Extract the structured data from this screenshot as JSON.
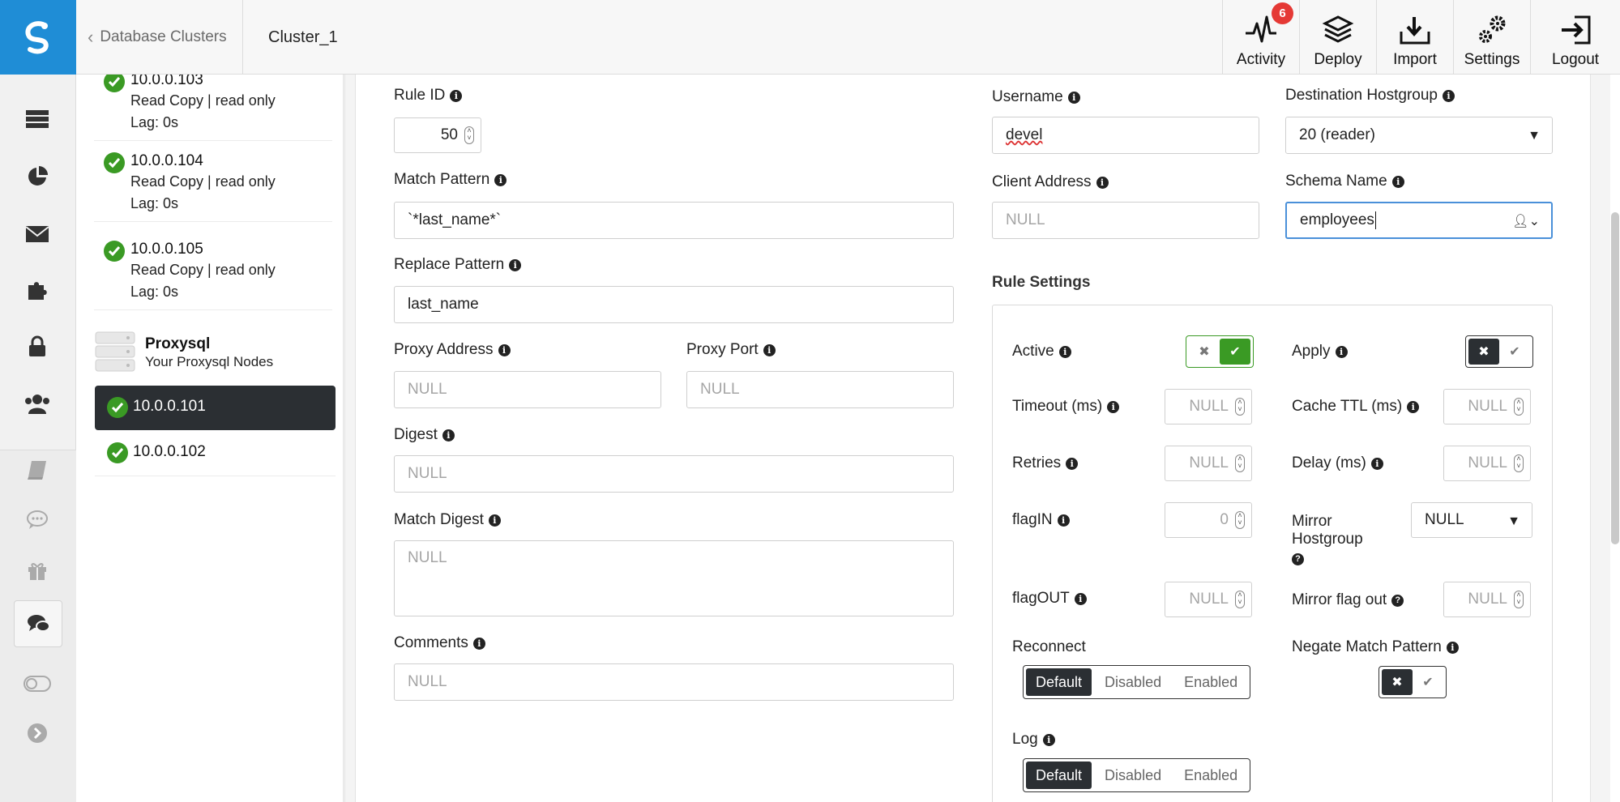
{
  "topbar": {
    "breadcrumb_label": "Database Clusters",
    "cluster_name": "Cluster_1",
    "activity": {
      "label": "Activity",
      "badge": "6"
    },
    "deploy_label": "Deploy",
    "import_label": "Import",
    "settings_label": "Settings",
    "logout_label": "Logout"
  },
  "nodes": [
    {
      "ip": "10.0.0.103",
      "role": "Read Copy | read only",
      "lag": "Lag: 0s"
    },
    {
      "ip": "10.0.0.104",
      "role": "Read Copy | read only",
      "lag": "Lag: 0s"
    },
    {
      "ip": "10.0.0.105",
      "role": "Read Copy | read only",
      "lag": "Lag: 0s"
    }
  ],
  "proxysql": {
    "title": "Proxysql",
    "subtitle": "Your Proxysql Nodes",
    "nodes": [
      "10.0.0.101",
      "10.0.0.102"
    ]
  },
  "form": {
    "rule_id": {
      "label": "Rule ID",
      "value": "50"
    },
    "match_pattern": {
      "label": "Match Pattern",
      "value": "`*last_name*`"
    },
    "replace_pattern": {
      "label": "Replace Pattern",
      "value": "last_name"
    },
    "proxy_address": {
      "label": "Proxy Address",
      "placeholder": "NULL"
    },
    "proxy_port": {
      "label": "Proxy Port",
      "placeholder": "NULL"
    },
    "digest": {
      "label": "Digest",
      "placeholder": "NULL"
    },
    "match_digest": {
      "label": "Match Digest",
      "placeholder": "NULL"
    },
    "comments": {
      "label": "Comments",
      "placeholder": "NULL"
    },
    "username": {
      "label": "Username",
      "value": "devel"
    },
    "destination_hostgroup": {
      "label": "Destination Hostgroup",
      "value": "20 (reader)"
    },
    "client_address": {
      "label": "Client Address",
      "placeholder": "NULL"
    },
    "schema_name": {
      "label": "Schema Name",
      "value": "employees"
    }
  },
  "rule_settings": {
    "title": "Rule Settings",
    "active": {
      "label": "Active",
      "state": "on"
    },
    "apply": {
      "label": "Apply",
      "state": "off"
    },
    "timeout": {
      "label": "Timeout (ms)",
      "value": "NULL"
    },
    "cache_ttl": {
      "label": "Cache TTL (ms)",
      "value": "NULL"
    },
    "retries": {
      "label": "Retries",
      "value": "NULL"
    },
    "delay": {
      "label": "Delay (ms)",
      "value": "NULL"
    },
    "flag_in": {
      "label": "flagIN",
      "value": "0"
    },
    "mirror_hostgroup": {
      "label": "Mirror Hostgroup",
      "value": "NULL"
    },
    "flag_out": {
      "label": "flagOUT",
      "value": "NULL"
    },
    "mirror_flag_out": {
      "label": "Mirror flag out",
      "value": "NULL"
    },
    "reconnect": {
      "label": "Reconnect",
      "options": [
        "Default",
        "Disabled",
        "Enabled"
      ],
      "selected": "Default"
    },
    "negate_match_pattern": {
      "label": "Negate Match Pattern",
      "state": "off"
    },
    "log": {
      "label": "Log",
      "options": [
        "Default",
        "Disabled",
        "Enabled"
      ],
      "selected": "Default"
    }
  }
}
